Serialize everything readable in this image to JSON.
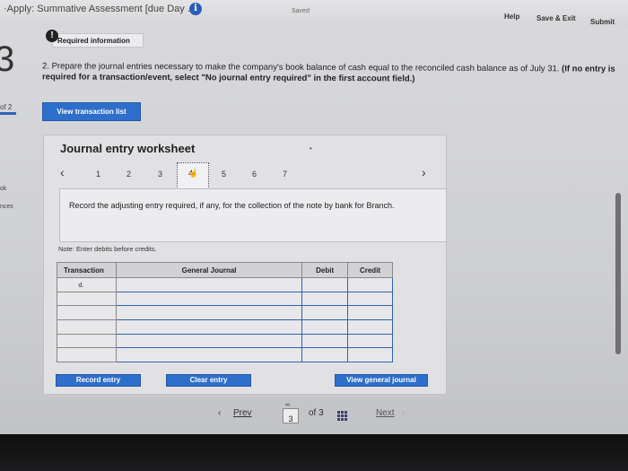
{
  "app": {
    "title": "·Apply: Summative Assessment [due Day ...",
    "saved": "Saved",
    "help": "Help",
    "save_exit": "Save & Exit",
    "submit": "Submit"
  },
  "left_edge": {
    "question_number": "3",
    "part_of": "of 2",
    "label_ok": "ok",
    "label_nces": "nces"
  },
  "required_info": {
    "icon_glyph": "!",
    "label": "Required information"
  },
  "instruction": {
    "lead": "2. Prepare the journal entries necessary to make the company's book balance of cash equal to the reconciled cash balance as of July 31.",
    "bold": "(If no entry is required for a transaction/event, select \"No journal entry required\" in the first account field.)"
  },
  "view_transaction_list_label": "View transaction list",
  "worksheet": {
    "title": "Journal entry worksheet",
    "pages": [
      "1",
      "2",
      "3",
      "4",
      "5",
      "6",
      "7"
    ],
    "selected_page": "4",
    "description": "Record the adjusting entry required, if any, for the collection of the note by bank for Branch.",
    "note": "Note: Enter debits before credits.",
    "columns": [
      "Transaction",
      "General Journal",
      "Debit",
      "Credit"
    ],
    "rows": [
      {
        "transaction": "d.",
        "general_journal": "",
        "debit": "",
        "credit": ""
      },
      {
        "transaction": "",
        "general_journal": "",
        "debit": "",
        "credit": ""
      },
      {
        "transaction": "",
        "general_journal": "",
        "debit": "",
        "credit": ""
      },
      {
        "transaction": "",
        "general_journal": "",
        "debit": "",
        "credit": ""
      },
      {
        "transaction": "",
        "general_journal": "",
        "debit": "",
        "credit": ""
      },
      {
        "transaction": "",
        "general_journal": "",
        "debit": "",
        "credit": ""
      }
    ],
    "record_entry_label": "Record entry",
    "clear_entry_label": "Clear entry",
    "view_general_journal_label": "View general journal"
  },
  "navigation": {
    "prev_label": "Prev",
    "current_page": "3",
    "of_label": "of 3",
    "next_label": "Next"
  },
  "colors": {
    "accent_blue": "#2e6fcc",
    "info_icon": "#2a5db8"
  }
}
